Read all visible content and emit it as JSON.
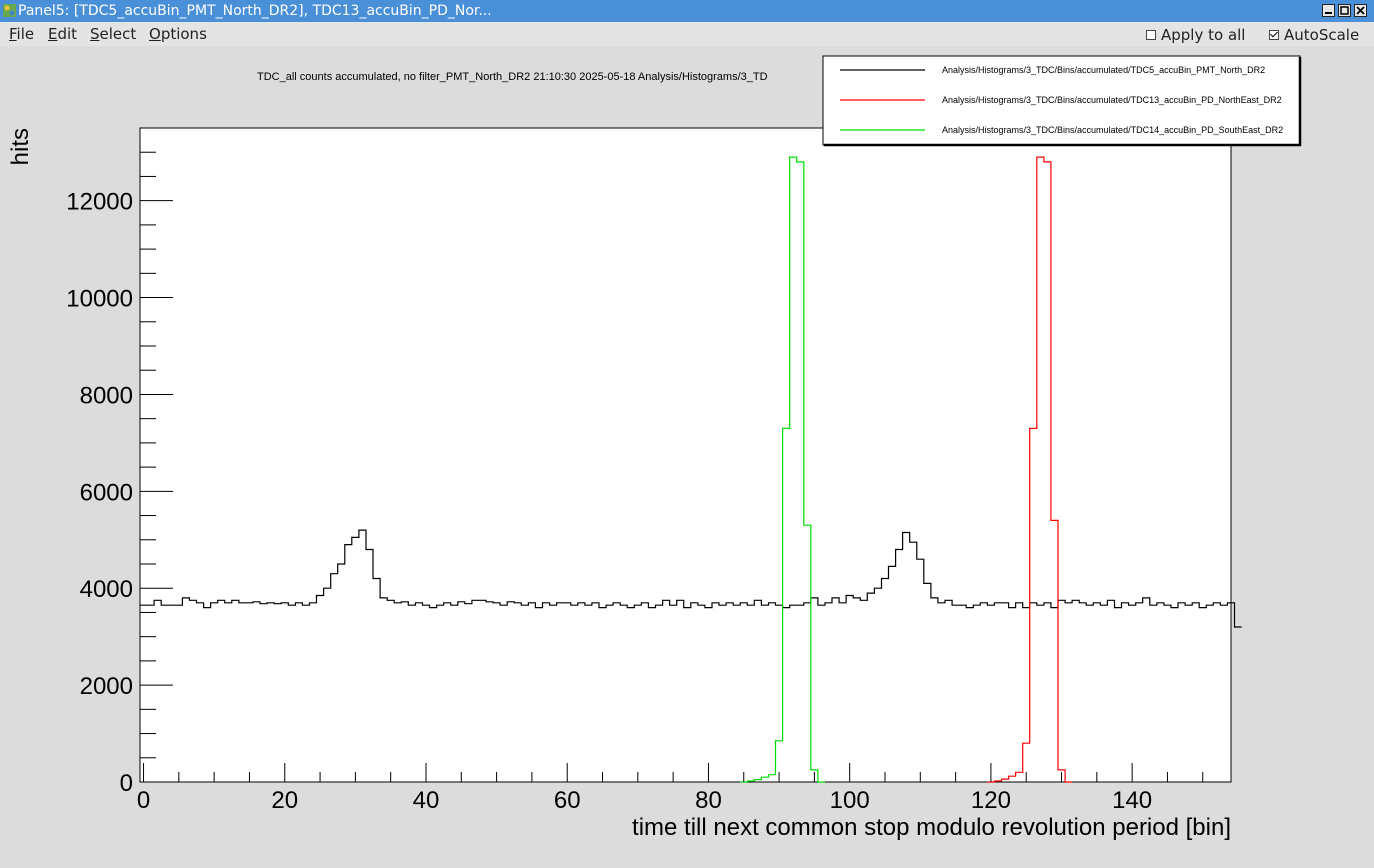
{
  "window": {
    "title": "Panel5: [TDC5_accuBin_PMT_North_DR2], TDC13_accuBin_PD_Nor..."
  },
  "menu": {
    "items": [
      {
        "label": "File",
        "key": "F",
        "rest": "ile"
      },
      {
        "label": "Edit",
        "key": "E",
        "rest": "dit"
      },
      {
        "label": "Select",
        "key": "S",
        "rest": "elect"
      },
      {
        "label": "Options",
        "key": "O",
        "rest": "ptions"
      }
    ],
    "apply_to_all": {
      "label": "Apply to all",
      "checked": false
    },
    "autoscale": {
      "label": "AutoScale",
      "checked": true
    }
  },
  "chart_data": {
    "type": "histogram",
    "title": "TDC_all counts accumulated, no filter_PMT_North_DR2  21:10:30  2025-05-18  Analysis/Histograms/3_TD",
    "xlabel": "time till next common stop modulo revolution period [bin]",
    "ylabel": "hits",
    "xlim": [
      -0.5,
      154
    ],
    "ylim": [
      0,
      13500
    ],
    "xticks": [
      0,
      20,
      40,
      60,
      80,
      100,
      120,
      140
    ],
    "yticks": [
      0,
      2000,
      4000,
      6000,
      8000,
      10000,
      12000
    ],
    "legend_position": "top-right",
    "series": [
      {
        "name": "Analysis/Histograms/3_TDC/Bins/accumulated/TDC5_accuBin_PMT_North_DR2",
        "color": "#000000",
        "start": -0.5,
        "values": [
          3650,
          3650,
          3750,
          3650,
          3650,
          3650,
          3800,
          3750,
          3700,
          3600,
          3700,
          3750,
          3700,
          3750,
          3700,
          3700,
          3720,
          3680,
          3700,
          3680,
          3700,
          3650,
          3700,
          3650,
          3700,
          3850,
          4000,
          4300,
          4500,
          4900,
          5050,
          5200,
          4800,
          4200,
          3800,
          3750,
          3700,
          3720,
          3650,
          3700,
          3650,
          3600,
          3650,
          3700,
          3650,
          3720,
          3680,
          3750,
          3750,
          3720,
          3700,
          3650,
          3720,
          3700,
          3650,
          3700,
          3600,
          3700,
          3650,
          3700,
          3700,
          3650,
          3700,
          3650,
          3700,
          3600,
          3650,
          3700,
          3650,
          3600,
          3650,
          3700,
          3600,
          3650,
          3750,
          3650,
          3750,
          3600,
          3700,
          3650,
          3600,
          3700,
          3650,
          3700,
          3650,
          3700,
          3650,
          3750,
          3650,
          3700,
          3650,
          3600,
          3650,
          3650,
          3700,
          3800,
          3650,
          3700,
          3800,
          3700,
          3850,
          3800,
          3750,
          3900,
          4000,
          4200,
          4450,
          4800,
          5150,
          4950,
          4600,
          4100,
          3800,
          3700,
          3750,
          3650,
          3650,
          3600,
          3650,
          3700,
          3650,
          3700,
          3700,
          3600,
          3700,
          3600,
          3700,
          3650,
          3700,
          3600,
          3750,
          3700,
          3750,
          3700,
          3650,
          3700,
          3650,
          3750,
          3600,
          3700,
          3650,
          3700,
          3800,
          3650,
          3700,
          3650,
          3600,
          3700,
          3650,
          3700,
          3600,
          3650,
          3700,
          3650,
          3700,
          3200
        ]
      },
      {
        "name": "Analysis/Histograms/3_TDC/Bins/accumulated/TDC13_accuBin_PD_NorthEast_DR2",
        "color": "#ff0000",
        "start": 119.5,
        "values": [
          0,
          20,
          60,
          120,
          200,
          800,
          7300,
          12900,
          12800,
          5400,
          250,
          0
        ]
      },
      {
        "name": "Analysis/Histograms/3_TDC/Bins/accumulated/TDC14_accuBin_PD_SouthEast_DR2",
        "color": "#00dd00",
        "start": 84.5,
        "values": [
          0,
          20,
          50,
          100,
          150,
          850,
          7300,
          12900,
          12800,
          5300,
          250,
          0
        ]
      }
    ]
  }
}
